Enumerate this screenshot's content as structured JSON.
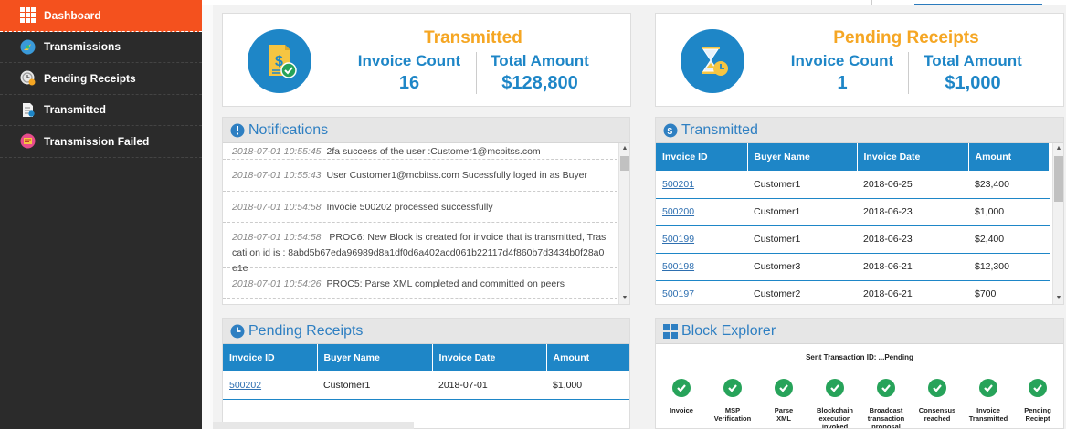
{
  "sidebar": {
    "items": [
      {
        "label": "Dashboard",
        "icon": "dashboard-grid-icon"
      },
      {
        "label": "Transmissions",
        "icon": "transmissions-icon"
      },
      {
        "label": "Pending Receipts",
        "icon": "pending-receipts-icon"
      },
      {
        "label": "Transmitted",
        "icon": "transmitted-doc-icon"
      },
      {
        "label": "Transmission Failed",
        "icon": "transmission-failed-icon"
      }
    ]
  },
  "stats": {
    "transmitted": {
      "title": "Transmitted",
      "count_label": "Invoice Count",
      "count": "16",
      "amount_label": "Total Amount",
      "amount": "$128,800"
    },
    "pending": {
      "title": "Pending Receipts",
      "count_label": "Invoice Count",
      "count": "1",
      "amount_label": "Total Amount",
      "amount": "$1,000"
    }
  },
  "notifications": {
    "title": "Notifications",
    "items": [
      {
        "ts": "2018-07-01 10:55:45",
        "text": "2fa success of the user :Customer1@mcbitss.com"
      },
      {
        "ts": "2018-07-01 10:55:43",
        "text": "User Customer1@mcbitss.com Sucessfully loged in as Buyer"
      },
      {
        "ts": "2018-07-01 10:54:58",
        "text": "Invocie 500202 processed successfully"
      },
      {
        "ts": "2018-07-01 10:54:58",
        "text": "PROC6: New Block is created for invoice that is transmitted, Trascati on id is : 8abd5b67eda96989d8a1df0d6a402acd061b22117d4f860b7d3434b0f28a0e1e"
      },
      {
        "ts": "2018-07-01 10:54:26",
        "text": "PROC5: Parse XML completed and committed on peers"
      }
    ]
  },
  "transmitted_table": {
    "title": "Transmitted",
    "columns": [
      "Invoice ID",
      "Buyer Name",
      "Invoice Date",
      "Amount"
    ],
    "rows": [
      [
        "500201",
        "Customer1",
        "2018-06-25",
        "$23,400"
      ],
      [
        "500200",
        "Customer1",
        "2018-06-23",
        "$1,000"
      ],
      [
        "500199",
        "Customer1",
        "2018-06-23",
        "$2,400"
      ],
      [
        "500198",
        "Customer3",
        "2018-06-21",
        "$12,300"
      ],
      [
        "500197",
        "Customer2",
        "2018-06-21",
        "$700"
      ]
    ]
  },
  "pending_table": {
    "title": "Pending Receipts",
    "columns": [
      "Invoice ID",
      "Buyer Name",
      "Invoice Date",
      "Amount"
    ],
    "rows": [
      [
        "500202",
        "Customer1",
        "2018-07-01",
        "$1,000"
      ]
    ]
  },
  "block_explorer": {
    "title": "Block Explorer",
    "status": "Sent Transaction ID: ...Pending",
    "steps": [
      {
        "line1": "Invoice",
        "line2": "",
        "line3": ""
      },
      {
        "line1": "MSP",
        "line2": "Verification",
        "line3": ""
      },
      {
        "line1": "Parse",
        "line2": "XML",
        "line3": ""
      },
      {
        "line1": "Blockchain",
        "line2": "execution",
        "line3": "invoked"
      },
      {
        "line1": "Broadcast",
        "line2": "transaction",
        "line3": "proposal"
      },
      {
        "line1": "Consensus",
        "line2": "reached",
        "line3": ""
      },
      {
        "line1": "Invoice",
        "line2": "Transmitted",
        "line3": ""
      },
      {
        "line1": "Pending",
        "line2": "Reciept",
        "line3": ""
      }
    ]
  },
  "colors": {
    "accent": "#f4511e",
    "primary": "#1e86c7",
    "highlight": "#f5a623",
    "success": "#27a35a"
  }
}
